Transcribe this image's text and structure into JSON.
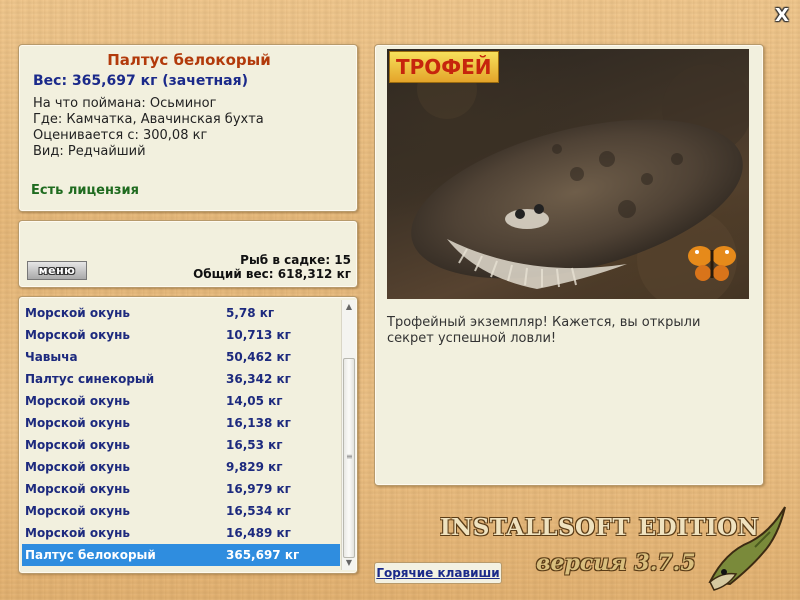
{
  "close_label": "X",
  "fish": {
    "title": "Палтус белокорый",
    "weight": "Вес: 365,697 кг (зачетная)",
    "bait": "На что поймана: Осьминог",
    "place": "Где: Камчатка, Авачинская бухта",
    "rated_from": "Оценивается с: 300,08 кг",
    "rarity": "Вид: Редчайший",
    "license": "Есть лицензия"
  },
  "keepnet": {
    "menu_label": "меню",
    "fish_count": "Рыб в садке: 15",
    "total_weight": "Общий вес: 618,312 кг"
  },
  "catch_list": [
    {
      "name": "Морской окунь",
      "weight": "5,78 кг"
    },
    {
      "name": "Морской окунь",
      "weight": "10,713 кг"
    },
    {
      "name": "Чавыча",
      "weight": "50,462 кг"
    },
    {
      "name": "Палтус синекорый",
      "weight": "36,342 кг"
    },
    {
      "name": "Морской окунь",
      "weight": "14,05 кг"
    },
    {
      "name": "Морской окунь",
      "weight": "16,138 кг"
    },
    {
      "name": "Морской окунь",
      "weight": "16,53 кг"
    },
    {
      "name": "Морской окунь",
      "weight": "9,829 кг"
    },
    {
      "name": "Морской окунь",
      "weight": "16,979 кг"
    },
    {
      "name": "Морской окунь",
      "weight": "16,534 кг"
    },
    {
      "name": "Морской окунь",
      "weight": "16,489 кг"
    },
    {
      "name": "Палтус белокорый",
      "weight": "365,697 кг",
      "selected": true
    }
  ],
  "photo": {
    "trophy_label": "ТРОФЕЙ",
    "caption": "Трофейный экземпляр! Кажется, вы открыли секрет успешной ловли!"
  },
  "hotkeys_label": "Горячие клавиши",
  "branding": {
    "edition": "INSTALLSOFT EDITION",
    "version": "версия 3.7.5"
  },
  "colors": {
    "title": "#b23a0b",
    "list_text": "#1d2a7e",
    "selection": "#2f8ddf",
    "license": "#1f6b1f",
    "panel_bg": "#f2f0de"
  }
}
